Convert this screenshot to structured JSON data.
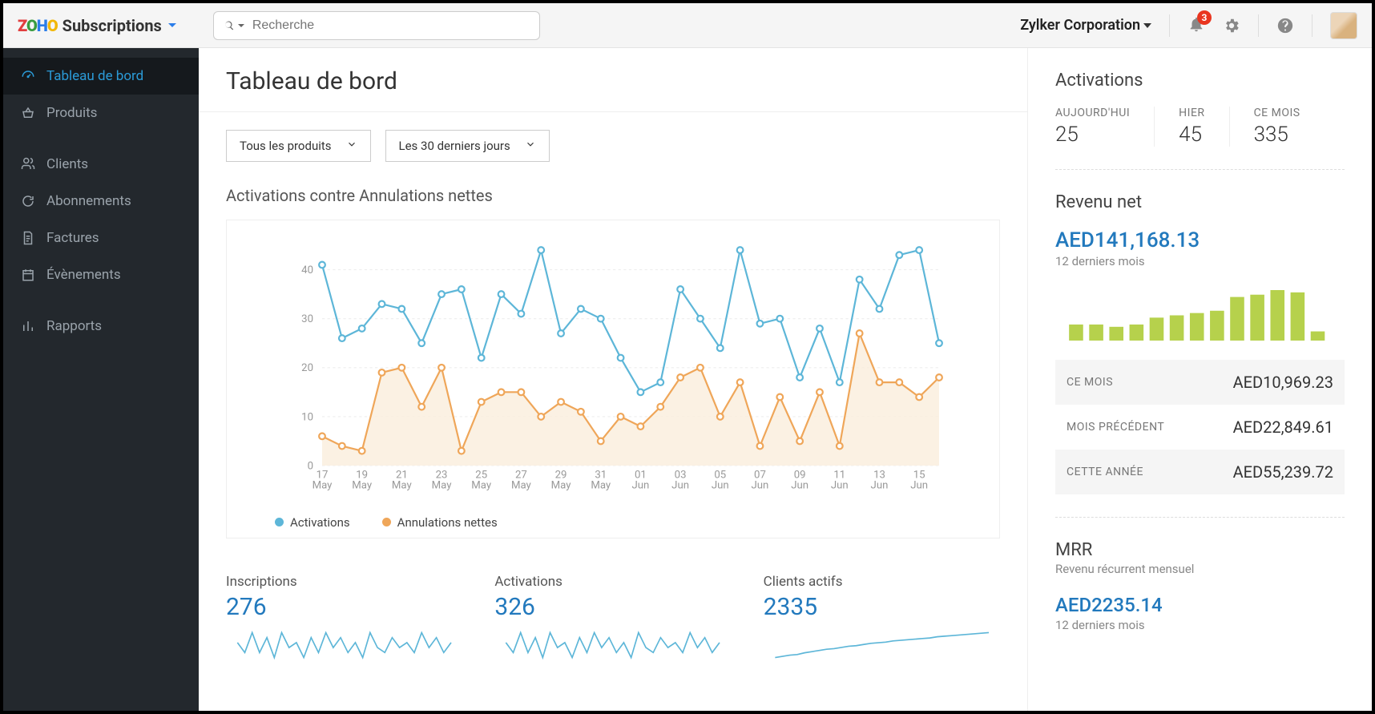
{
  "header": {
    "brand_sub": "Subscriptions",
    "search_placeholder": "Recherche",
    "org_name": "Zylker Corporation",
    "notification_count": "3"
  },
  "sidebar": {
    "items": [
      {
        "label": "Tableau de bord"
      },
      {
        "label": "Produits"
      },
      {
        "label": "Clients"
      },
      {
        "label": "Abonnements"
      },
      {
        "label": "Factures"
      },
      {
        "label": "Évènements"
      },
      {
        "label": "Rapports"
      }
    ]
  },
  "page": {
    "title": "Tableau de bord",
    "filter_product": "Tous les produits",
    "filter_period": "Les 30 derniers jours"
  },
  "chart_section_title": "Activations contre Annulations nettes",
  "legend": {
    "activations": "Activations",
    "cancellations": "Annulations nettes"
  },
  "chart_data": {
    "type": "line",
    "xlabel": "",
    "ylabel": "",
    "ylim": [
      0,
      45
    ],
    "y_ticks": [
      0,
      10,
      20,
      30,
      40
    ],
    "x_labels": [
      "17 May",
      "19 May",
      "21 May",
      "23 May",
      "25 May",
      "27 May",
      "29 May",
      "31 May",
      "01 Jun",
      "03 Jun",
      "05 Jun",
      "07 Jun",
      "09 Jun",
      "11 Jun",
      "13 Jun",
      "15 Jun"
    ],
    "series": [
      {
        "name": "Activations",
        "color": "#5db6d8",
        "values": [
          41,
          26,
          28,
          33,
          32,
          25,
          35,
          36,
          22,
          35,
          31,
          44,
          27,
          32,
          30,
          22,
          15,
          17,
          36,
          30,
          24,
          44,
          29,
          30,
          18,
          28,
          17,
          38,
          32,
          43,
          44,
          25
        ]
      },
      {
        "name": "Annulations nettes",
        "color": "#efa659",
        "values": [
          6,
          4,
          3,
          19,
          20,
          12,
          20,
          3,
          13,
          15,
          15,
          10,
          13,
          11,
          5,
          10,
          8,
          12,
          18,
          20,
          10,
          17,
          4,
          14,
          5,
          15,
          4,
          27,
          17,
          17,
          14,
          18
        ]
      }
    ]
  },
  "stats": {
    "inscriptions": {
      "label": "Inscriptions",
      "value": "276"
    },
    "activations": {
      "label": "Activations",
      "value": "326"
    },
    "clients_actifs": {
      "label": "Clients actifs",
      "value": "2335"
    }
  },
  "sparklines": {
    "inscriptions": [
      12,
      10,
      14,
      10,
      13,
      9,
      14,
      11,
      12,
      9,
      13,
      10,
      14,
      11,
      13,
      10,
      12,
      9,
      14,
      11,
      10,
      13,
      11,
      12,
      10,
      14,
      11,
      13,
      10,
      12
    ],
    "activations": [
      13,
      11,
      15,
      11,
      14,
      10,
      15,
      12,
      13,
      10,
      14,
      11,
      15,
      12,
      14,
      11,
      13,
      10,
      15,
      12,
      11,
      14,
      12,
      13,
      11,
      15,
      12,
      14,
      11,
      13
    ],
    "clients_actifs": [
      5,
      5.2,
      5.4,
      5.5,
      5.8,
      6.0,
      6.2,
      6.4,
      6.5,
      6.7,
      6.9,
      7.0,
      7.2,
      7.4,
      7.5,
      7.6,
      7.8,
      7.9,
      8.0,
      8.1,
      8.2,
      8.3,
      8.5,
      8.6,
      8.7,
      8.8,
      8.9,
      9.0,
      9.1,
      9.2
    ]
  },
  "right": {
    "activations_title": "Activations",
    "today_lbl": "AUJOURD'HUI",
    "today_val": "25",
    "yesterday_lbl": "HIER",
    "yesterday_val": "45",
    "month_lbl": "CE MOIS",
    "month_val": "335",
    "revenu_title": "Revenu net",
    "revenu_big": "AED141,168.13",
    "revenu_sub": "12 derniers mois",
    "revenu_bars": [
      14,
      14,
      12,
      14,
      20,
      22,
      24,
      26,
      38,
      40,
      44,
      42,
      8
    ],
    "rows": [
      {
        "k": "CE MOIS",
        "v": "AED10,969.23"
      },
      {
        "k": "MOIS PRÉCÉDENT",
        "v": "AED22,849.61"
      },
      {
        "k": "CETTE ANNÉE",
        "v": "AED55,239.72"
      }
    ],
    "mrr_title": "MRR",
    "mrr_sub": "Revenu récurrent mensuel",
    "mrr_val": "AED2235.14",
    "mrr_val_sub": "12 derniers mois"
  }
}
